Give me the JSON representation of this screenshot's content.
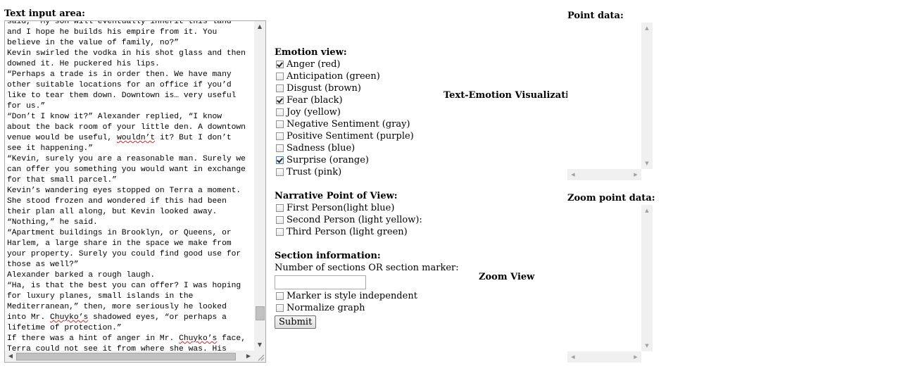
{
  "text_area": {
    "title": "Text input area:",
    "lines": [
      "said, “My son will eventually inherit this land",
      "and I hope he builds his empire from it. You",
      "believe in the value of family, no?”",
      "Kevin swirled the vodka in his shot glass and then",
      "downed it. He puckered his lips.",
      "“Perhaps a trade is in order then. We have many",
      "other suitable locations for an office if you’d",
      "like to tear them down. Downtown is… very useful",
      "for us.”",
      "“Don’t I know it?” Alexander replied, “I know",
      "about the back room of your little den. A downtown",
      "venue would be useful, wouldn’t it? But I don’t",
      "see it happening.”",
      "“Kevin, surely you are a reasonable man. Surely we",
      "can offer you something you would want in exchange",
      "for that small parcel.”",
      "Kevin’s wandering eyes stopped on Terra a moment.",
      "She stood frozen and wondered if this had been",
      "their plan all along, but Kevin looked away.",
      "“Nothing,” he said.",
      "“Apartment buildings in Brooklyn, or Queens, or",
      "Harlem, a large share in the space we make from",
      "your property. Surely you could find good use for",
      "those as well?”",
      "Alexander barked a rough laugh.",
      "“Ha, is that the best you can offer? I was hoping",
      "for luxury planes, small islands in the",
      "Mediterranean,” then, more seriously he looked",
      "into Mr. Chuyko’s shadowed eyes, “or perhaps a",
      "lifetime of protection.”",
      "If there was a hint of anger in Mr. Chuyko’s face,",
      "Terra could not see it from where she was. His"
    ],
    "vertical_scroll_position": 0.93,
    "horizontal_scroll_position": 0.0
  },
  "emotion_view": {
    "title": "Emotion view:",
    "options": [
      {
        "label": "Anger (red)",
        "checked": true
      },
      {
        "label": "Anticipation (green)",
        "checked": false
      },
      {
        "label": "Disgust (brown)",
        "checked": false
      },
      {
        "label": "Fear (black)",
        "checked": true
      },
      {
        "label": "Joy (yellow)",
        "checked": false
      },
      {
        "label": "Negative Sentiment (gray)",
        "checked": false
      },
      {
        "label": "Positive Sentiment (purple)",
        "checked": false
      },
      {
        "label": "Sadness (blue)",
        "checked": false
      },
      {
        "label": "Surprise (orange)",
        "checked": true
      },
      {
        "label": "Trust (pink)",
        "checked": false
      }
    ]
  },
  "narrative_pov": {
    "title": "Narrative Point of View:",
    "options": [
      {
        "label": "First Person(light blue)",
        "checked": false
      },
      {
        "label": "Second Person (light yellow):",
        "checked": false
      },
      {
        "label": "Third Person (light green)",
        "checked": false
      }
    ]
  },
  "section_info": {
    "title": "Section information:",
    "prompt": "Number of sections OR section marker:",
    "input_value": "",
    "options": [
      {
        "label": "Marker is style independent",
        "checked": false
      },
      {
        "label": "Normalize graph",
        "checked": false
      }
    ],
    "submit_label": "Submit"
  },
  "visualization": {
    "title": "Text-Emotion Visualization",
    "zoom_title": "Zoom View"
  },
  "point_data": {
    "title": "Point data:",
    "zoom_title": "Zoom point data:"
  },
  "colors": {
    "scrollbar_track": "#f0f0f0",
    "scrollbar_thumb": "#c1c1c1",
    "border": "#a9a9a9",
    "focus": "#3b7fd1"
  }
}
